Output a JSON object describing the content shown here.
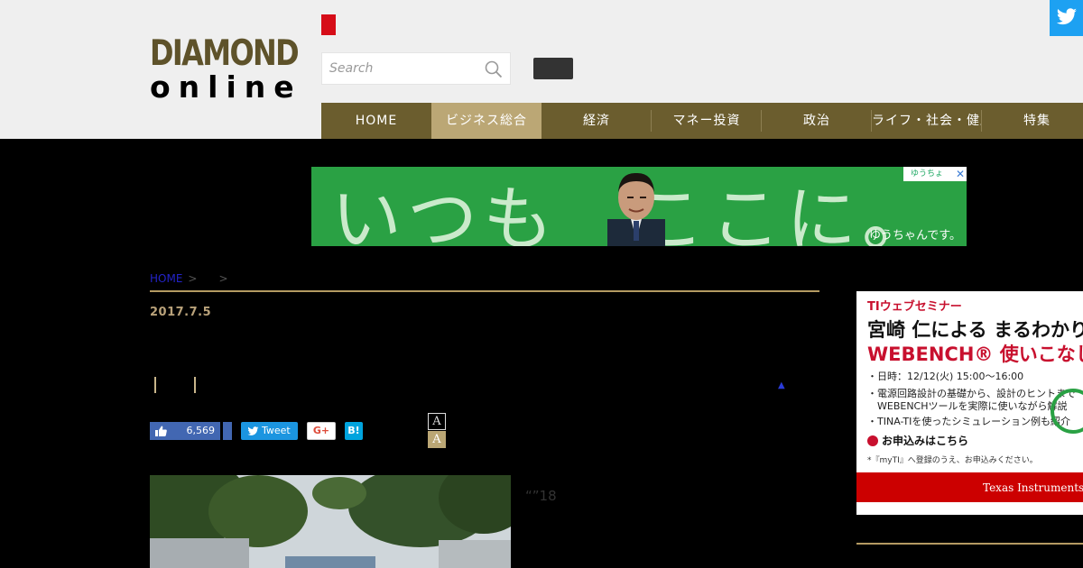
{
  "logo": {
    "line1": "DIAMOND",
    "line2": "online"
  },
  "search": {
    "placeholder": "Search"
  },
  "nav": {
    "items": [
      {
        "label": "HOME"
      },
      {
        "label": "ビジネス総合"
      },
      {
        "label": "経済"
      },
      {
        "label": "マネー投資"
      },
      {
        "label": "政治"
      },
      {
        "label": "ライフ・社会・健康"
      },
      {
        "label": "特集"
      }
    ]
  },
  "banner": {
    "headline": "いつも　ここに。",
    "sub": "ゆうちゃんです。",
    "ad_tag": "ゆうちょ",
    "close": "✕"
  },
  "breadcrumb": {
    "home": "HOME",
    "sep": ">"
  },
  "article": {
    "date": "2017.7.5",
    "triangle": "▲",
    "caption": "“”18"
  },
  "social": {
    "like_count": "6,569",
    "tweet": "Tweet",
    "gplus": "G+",
    "hatena": "B!",
    "font_small": "A",
    "font_large": "A"
  },
  "side_ad": {
    "tag": "TIウェブセミナー",
    "title1": "宮崎 仁による まるわかり",
    "title2": "WEBENCH® 使いこなし術",
    "line1": "・日時：12/12(火) 15:00～16:00",
    "line2": "・電源回路設計の基礎から、設計のヒントまで",
    "line3": "　WEBENCHツールを実際に使いながら解説",
    "line4": "・TINA-TIを使ったシミュレーション例も紹介",
    "apply": "お申込みはこちら",
    "note": "*『myTI』へ登録のうえ、お申込みください。",
    "footer": "Texas Instruments"
  },
  "colors": {
    "nav_bg": "#6b5d2e",
    "nav_active": "#bba775",
    "gold": "#b49a62",
    "twitter": "#1da1f2",
    "brand_red": "#d60d18"
  }
}
